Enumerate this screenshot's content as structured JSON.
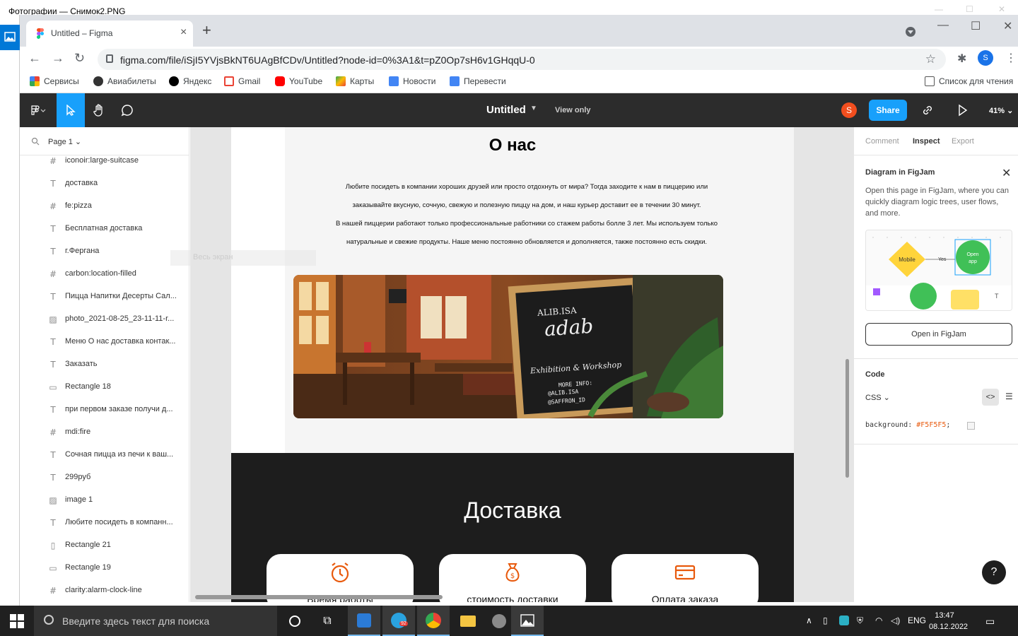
{
  "photos_window": {
    "title": "Фотографии — Снимок2.PNG"
  },
  "browser": {
    "tab_title": "Untitled – Figma",
    "url": "figma.com/file/iSjI5YVjsBkNT6UAgBfCDv/Untitled?node-id=0%3A1&t=pZ0Op7sH6v1GHqqU-0",
    "profile_letter": "S",
    "bookmarks": [
      "Сервисы",
      "Авиабилеты",
      "Яндекс",
      "Gmail",
      "YouTube",
      "Карты",
      "Новости",
      "Перевести"
    ],
    "reading_list": "Список для чтения"
  },
  "figma_toolbar": {
    "file_title": "Untitled",
    "view_mode": "View only",
    "user_letter": "S",
    "share_label": "Share",
    "zoom": "41%"
  },
  "layers_panel": {
    "page_name": "Page 1",
    "items": [
      {
        "icon": "#",
        "name": "iconoir:large-suitcase"
      },
      {
        "icon": "T",
        "name": "доставка"
      },
      {
        "icon": "#",
        "name": "fe:pizza"
      },
      {
        "icon": "T",
        "name": "Бесплатная доставка"
      },
      {
        "icon": "T",
        "name": "г.Фергана"
      },
      {
        "icon": "#",
        "name": "carbon:location-filled"
      },
      {
        "icon": "T",
        "name": "Пицца Напитки Десерты Сал..."
      },
      {
        "icon": "▨",
        "name": "photo_2021-08-25_23-11-11-r..."
      },
      {
        "icon": "T",
        "name": "Меню О нас доставка контак..."
      },
      {
        "icon": "T",
        "name": "Заказать"
      },
      {
        "icon": "▭",
        "name": "Rectangle 18"
      },
      {
        "icon": "T",
        "name": "при первом заказе получи д..."
      },
      {
        "icon": "#",
        "name": "mdi:fire"
      },
      {
        "icon": "T",
        "name": "Сочная пицца из печи к ваш..."
      },
      {
        "icon": "T",
        "name": "299руб"
      },
      {
        "icon": "▨",
        "name": "image 1"
      },
      {
        "icon": "T",
        "name": "Любите посидеть в компанн..."
      },
      {
        "icon": "▯",
        "name": "Rectangle 21"
      },
      {
        "icon": "▭",
        "name": "Rectangle 19"
      },
      {
        "icon": "#",
        "name": "clarity:alarm-clock-line"
      }
    ]
  },
  "canvas": {
    "ghost_label": "Весь экран",
    "about_title": "О нас",
    "about_lines": [
      "Любите посидеть в компании хороших друзей или просто отдохнуть от мира? Тогда заходите к нам в пиццерию или",
      "заказывайте вкусную, сочную, свежую и полезную пиццу на дом, и наш курьер доставит ее в течении 30 минут.",
      "В нашей пиццерии работают только профессиональные работники со стажем работы болле 3 лет. Мы используем только",
      "натуральные и свежие продукты. Наше меню постоянно обновляется и дополняется, также постоянно есть скидки."
    ],
    "chalkboard": {
      "line1": "ALIB.ISA",
      "line2": "adab",
      "line3": "Exhibition & Workshop",
      "line4": "MORE INFO:",
      "line5": "@ALIB.ISA",
      "line6": "@SAFFRON_ID"
    },
    "delivery_title": "Доставка",
    "cards": [
      {
        "label": "Время работы",
        "icon": "alarm-clock-icon"
      },
      {
        "label": "стоимость доставки",
        "icon": "money-bag-icon"
      },
      {
        "label": "Оплата заказа",
        "icon": "credit-card-icon"
      }
    ]
  },
  "inspect_panel": {
    "tabs": [
      "Comment",
      "Inspect",
      "Export"
    ],
    "active_tab": "Inspect",
    "figjam_title": "Diagram in FigJam",
    "figjam_text": "Open this page in FigJam, where you can quickly diagram logic trees, user flows, and more.",
    "figjam_diagram": {
      "node1": "Mobile",
      "edge": "Yes",
      "node2_line1": "Open",
      "node2_line2": "app"
    },
    "open_button": "Open in FigJam",
    "code_title": "Code",
    "language": "CSS",
    "code_property": "background:",
    "code_value": "#F5F5F5",
    "code_end": ";"
  },
  "taskbar": {
    "search_placeholder": "Введите здесь текст для поиска",
    "telegram_badge": "92",
    "language": "ENG",
    "time": "13:47",
    "date": "08.12.2022"
  },
  "colors": {
    "figma_dark": "#2c2c2c",
    "accent": "#18a0fb",
    "orange": "#f24e1e",
    "card_icon": "#e8590c"
  }
}
